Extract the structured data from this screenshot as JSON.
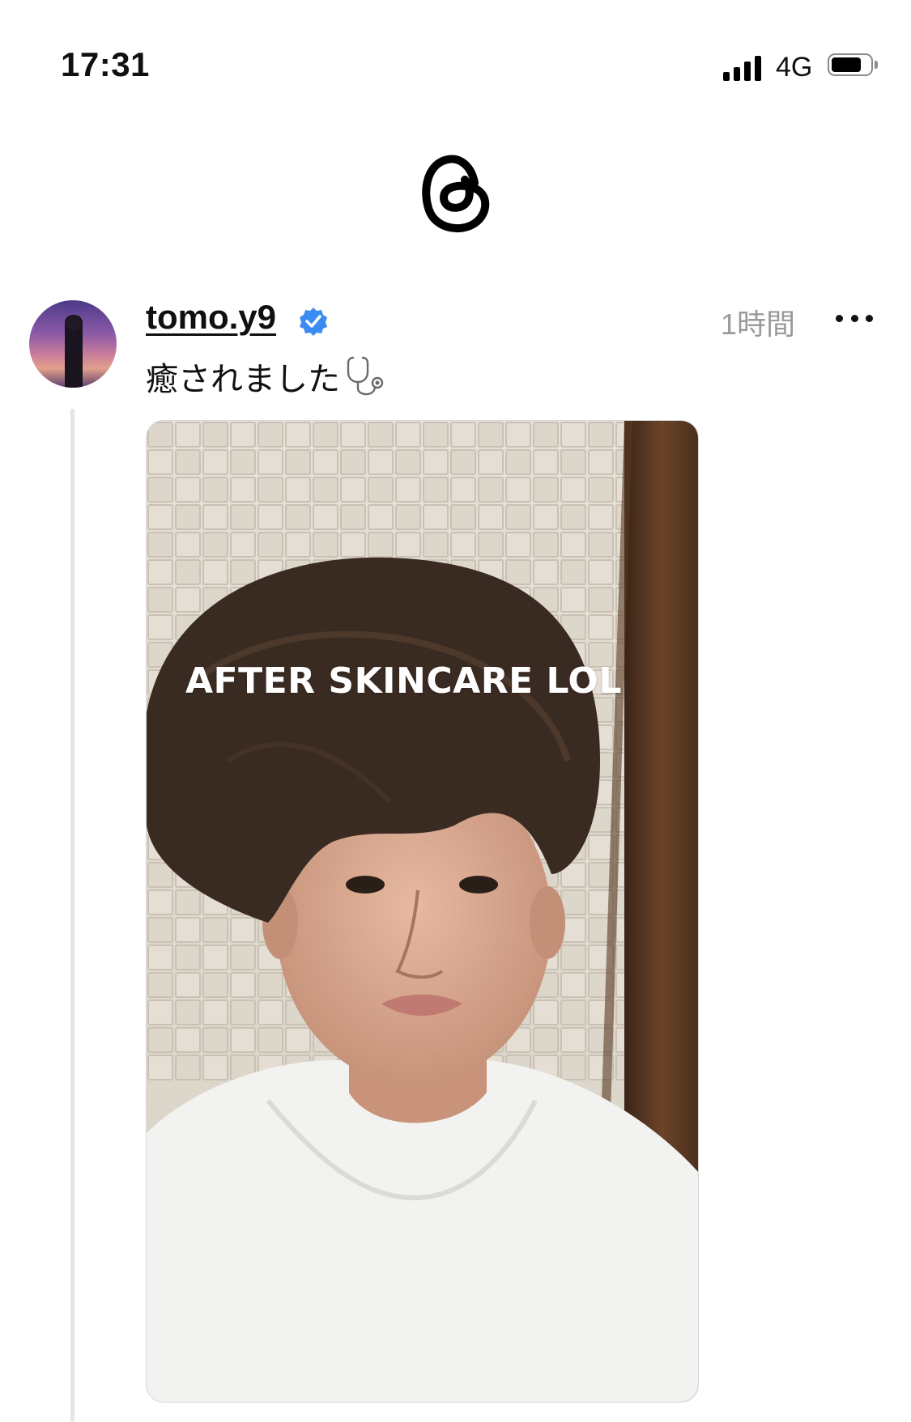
{
  "status_bar": {
    "time": "17:31",
    "network": "4G",
    "icons": [
      "signal-icon",
      "battery-icon"
    ]
  },
  "header": {
    "logo": "threads-logo-icon"
  },
  "post": {
    "username": "tomo.y9",
    "verified": true,
    "timestamp": "1時間",
    "caption": "癒されました",
    "caption_emoji": "stethoscope-icon",
    "media": {
      "overlay_text": "AFTER SKINCARE LOL",
      "description_icon": "selfie-photo"
    }
  },
  "colors": {
    "accent_verified": "#3b8cf2",
    "thread_line": "#e5e5e5",
    "muted_text": "#9a9a9a"
  }
}
